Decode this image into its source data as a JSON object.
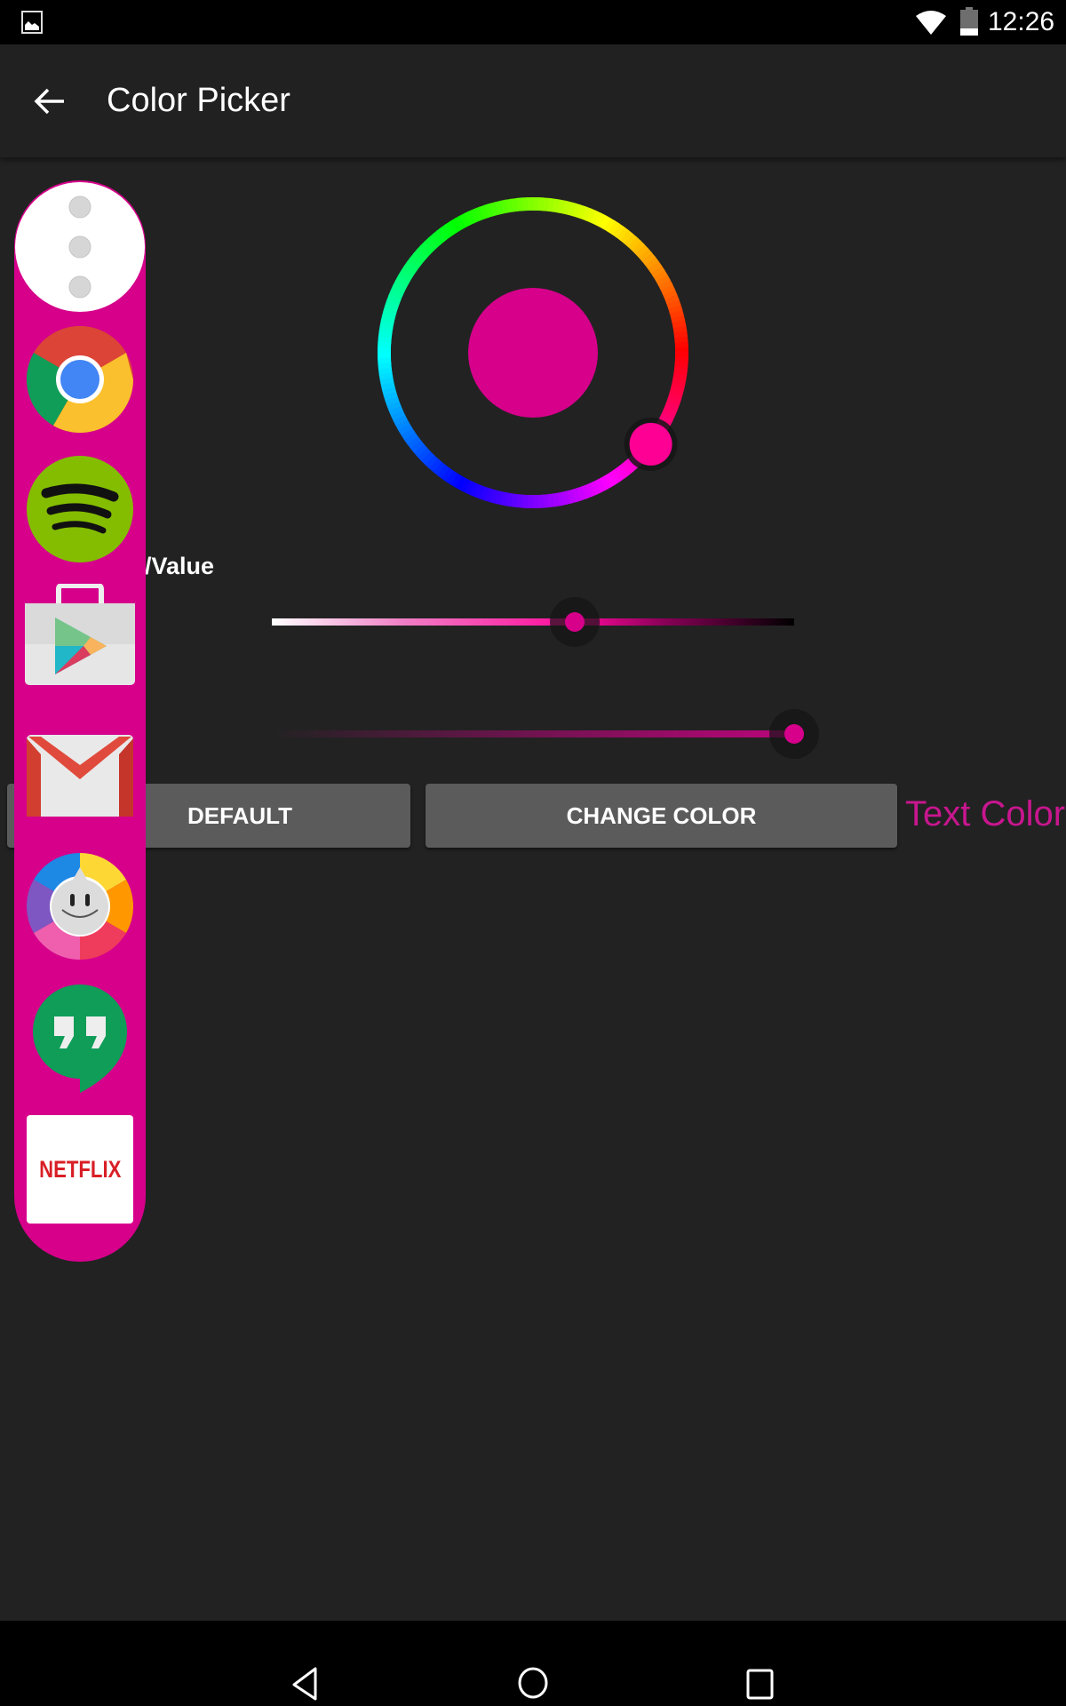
{
  "status_bar": {
    "time": "12:26",
    "icons": [
      "image-notification-icon",
      "wifi-icon",
      "battery-icon"
    ],
    "battery_level": 0.25
  },
  "toolbar": {
    "title": "Color Picker",
    "back_icon": "arrow-left-icon"
  },
  "color_picker": {
    "selected_color": "#d6008b",
    "hue_degrees": 322,
    "saturation_value_label": "/Value",
    "saturation_value_slider": 0.58,
    "opacity_slider": 1.0
  },
  "buttons": {
    "default_label": "DEFAULT",
    "change_color_label": "CHANGE COLOR"
  },
  "text_color_label": "Text Color",
  "colors": {
    "accent": "#d6008b",
    "sidebar": "#d6008b",
    "background": "#222222",
    "toolbar": "#212121",
    "button": "#5b5b5c",
    "text_color_label": "#c8168f"
  },
  "sidebar": {
    "apps": [
      {
        "name": "More",
        "icon": "more-vertical-icon"
      },
      {
        "name": "Chrome",
        "icon": "chrome-icon"
      },
      {
        "name": "Spotify",
        "icon": "spotify-icon"
      },
      {
        "name": "Play Store",
        "icon": "play-store-icon"
      },
      {
        "name": "Gmail",
        "icon": "gmail-icon"
      },
      {
        "name": "Trivia Crack",
        "icon": "trivia-crack-icon"
      },
      {
        "name": "Hangouts",
        "icon": "hangouts-icon"
      },
      {
        "name": "Netflix",
        "icon": "netflix-icon",
        "label": "NETFLIX"
      }
    ]
  },
  "nav_bar": {
    "icons": [
      "back-nav-icon",
      "home-nav-icon",
      "recents-nav-icon"
    ]
  }
}
